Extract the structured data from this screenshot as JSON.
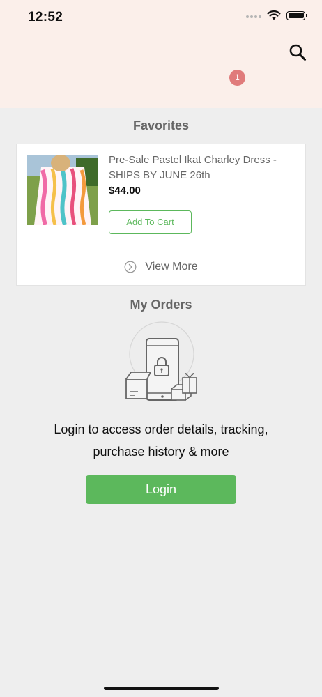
{
  "status_bar": {
    "time": "12:52"
  },
  "header": {
    "cart_count": "1",
    "search_icon": "search-icon"
  },
  "favorites": {
    "title": "Favorites",
    "items": [
      {
        "name": "Pre-Sale Pastel Ikat Charley Dress - SHIPS BY JUNE 26th",
        "price": "$44.00",
        "add_to_cart_label": "Add To Cart"
      }
    ],
    "view_more_label": "View More"
  },
  "orders": {
    "title": "My Orders",
    "message": "Login to access order details, tracking, purchase history & more",
    "login_label": "Login"
  },
  "colors": {
    "header_bg": "#fbefea",
    "page_bg": "#eeeeee",
    "accent_green": "#5cb85c",
    "badge": "#e07b7b"
  }
}
